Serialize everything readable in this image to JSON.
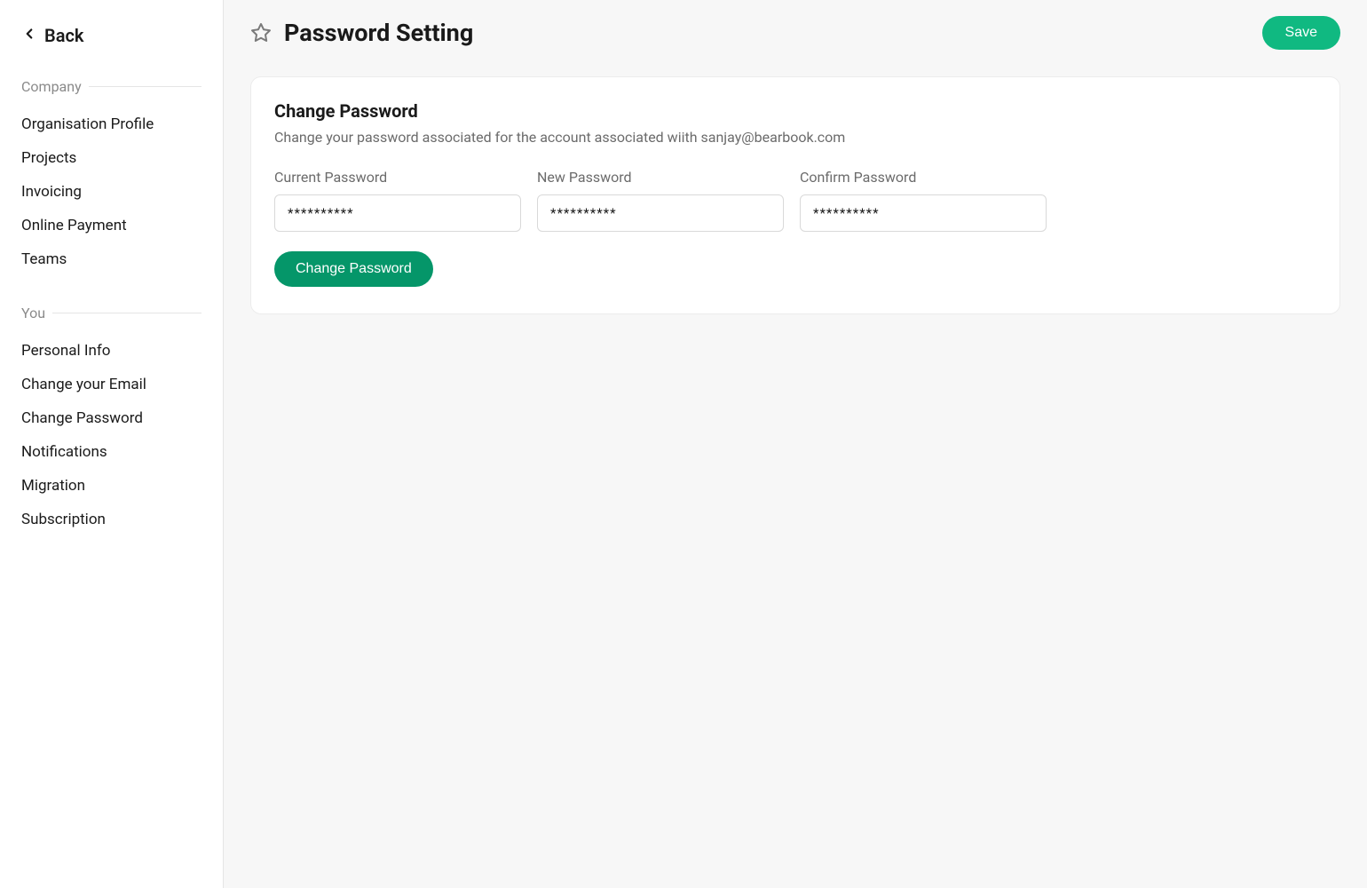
{
  "sidebar": {
    "back_label": "Back",
    "groups": [
      {
        "label": "Company",
        "items": [
          {
            "label": "Organisation Profile"
          },
          {
            "label": "Projects"
          },
          {
            "label": "Invoicing"
          },
          {
            "label": "Online Payment"
          },
          {
            "label": "Teams"
          }
        ]
      },
      {
        "label": "You",
        "items": [
          {
            "label": "Personal Info"
          },
          {
            "label": "Change your Email"
          },
          {
            "label": "Change Password"
          },
          {
            "label": "Notifications"
          },
          {
            "label": "Migration"
          },
          {
            "label": "Subscription"
          }
        ]
      }
    ]
  },
  "header": {
    "title": "Password Setting",
    "save_label": "Save"
  },
  "card": {
    "title": "Change Password",
    "subtitle": "Change your password associated for the account associated wiith sanjay@bearbook.com",
    "fields": {
      "current": {
        "label": "Current Password",
        "value": "**********"
      },
      "new": {
        "label": "New Password",
        "value": "**********"
      },
      "confirm": {
        "label": "Confirm Password",
        "value": "**********"
      }
    },
    "submit_label": "Change Password"
  }
}
